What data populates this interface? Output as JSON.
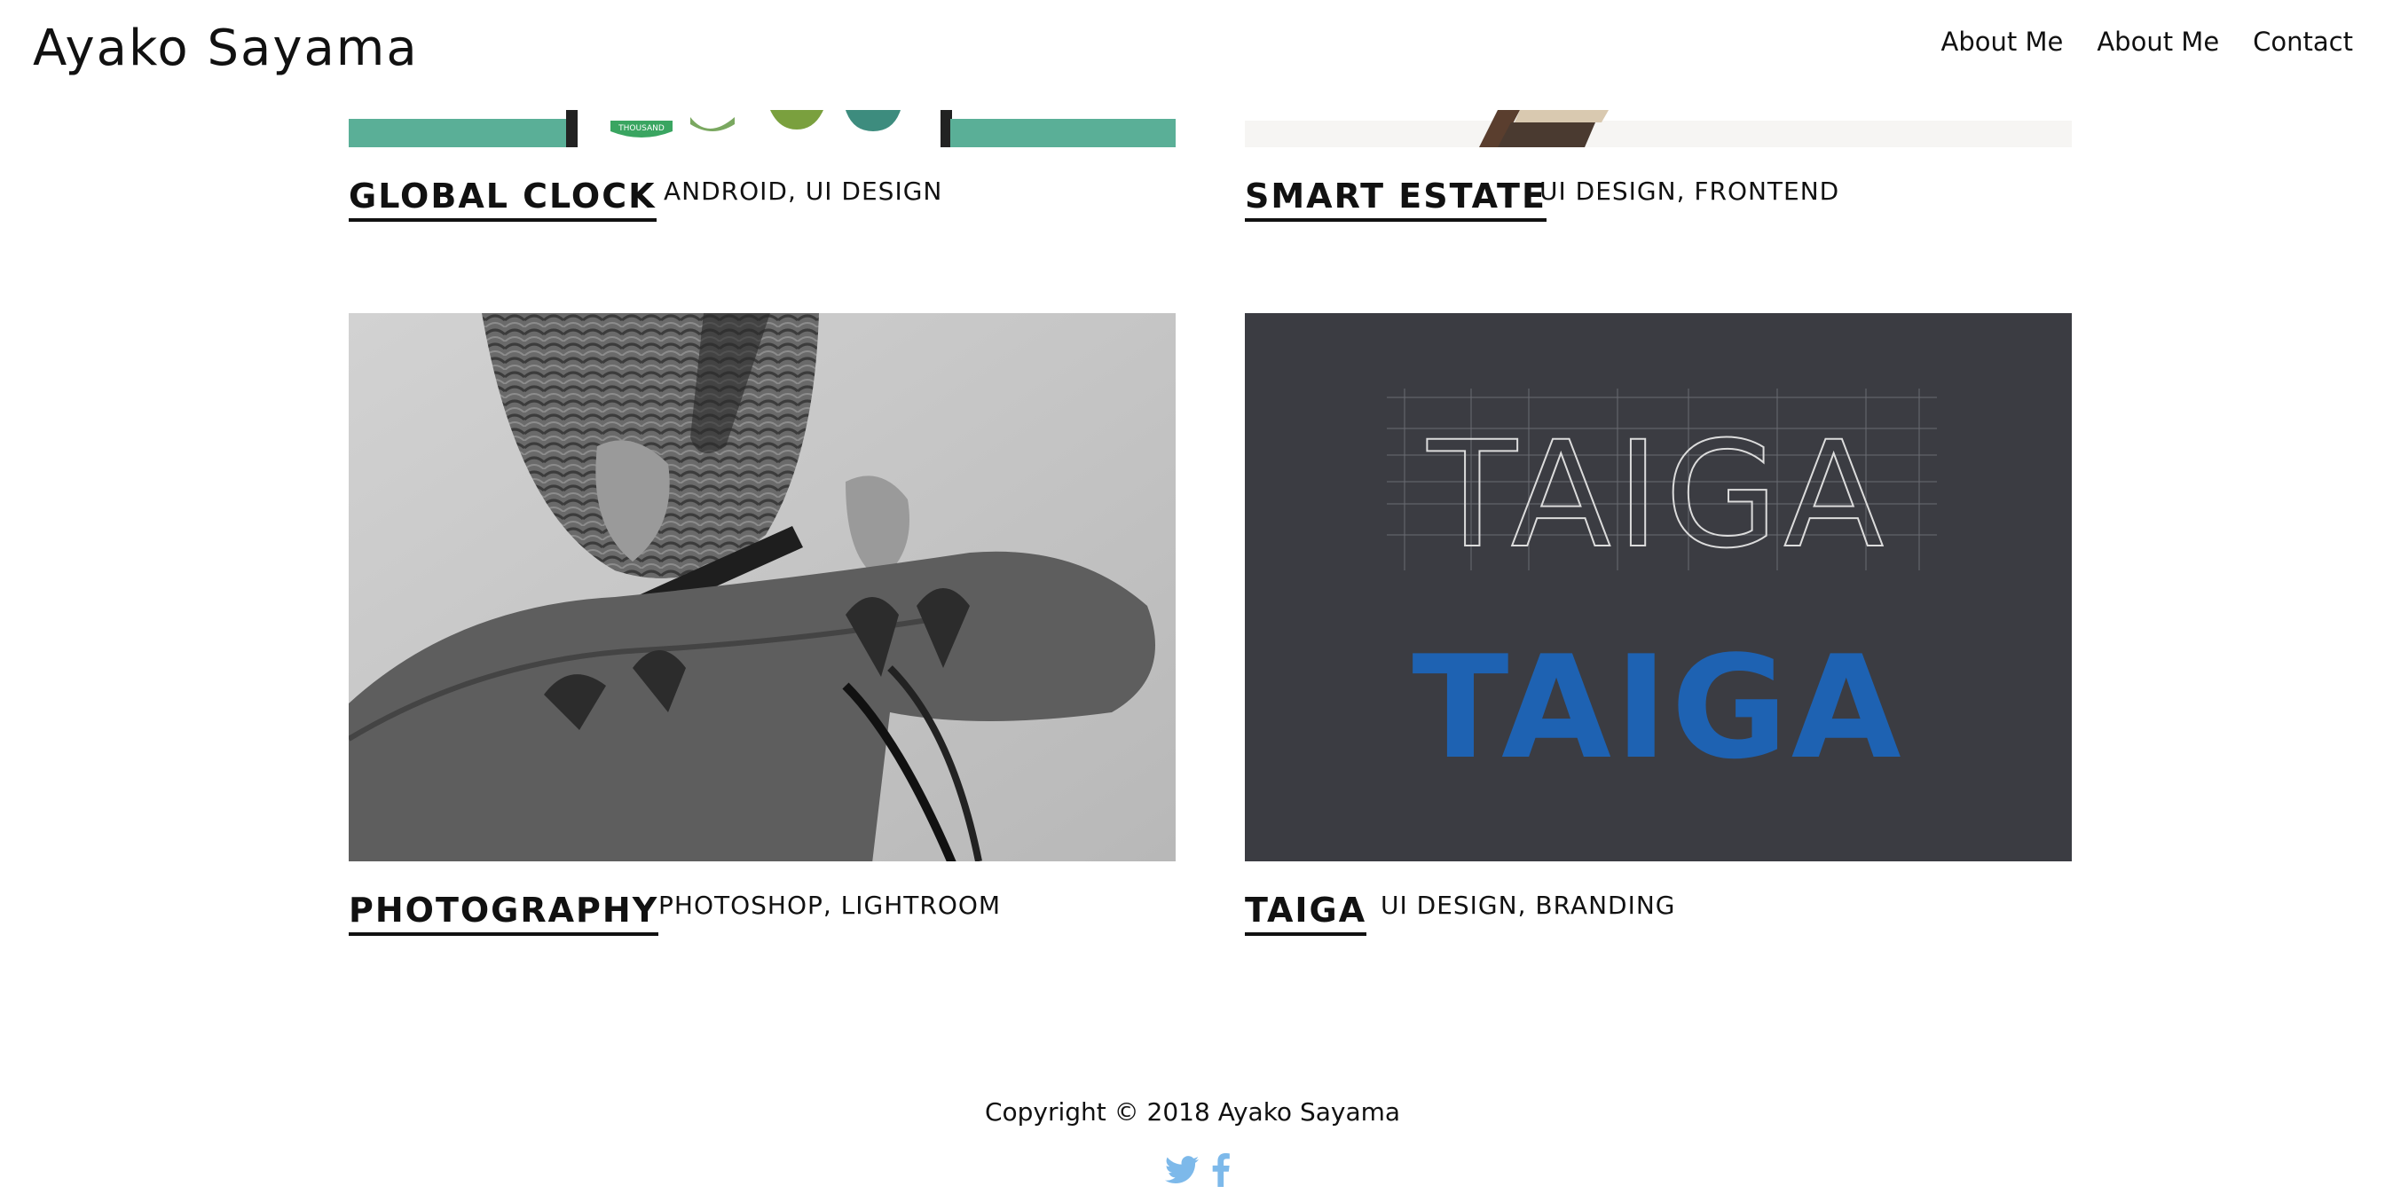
{
  "header": {
    "brand": "Ayako Sayama",
    "nav": [
      {
        "label": "About Me"
      },
      {
        "label": "About Me"
      },
      {
        "label": "Contact"
      }
    ]
  },
  "projects": [
    {
      "title": "GLOBAL CLOCK",
      "tags": "ANDROID, UI DESIGN"
    },
    {
      "title": "SMART ESTATE",
      "tags": "UI DESIGN, FRONTEND"
    },
    {
      "title": "PHOTOGRAPHY",
      "tags": "PHOTOSHOP, LIGHTROOM"
    },
    {
      "title": "TAIGA",
      "tags": "UI DESIGN, BRANDING"
    }
  ],
  "global_clock_badge": "THOUSAND",
  "taiga_logo": {
    "outline_text": "TAIGA",
    "solid_text": "TAIGA"
  },
  "footer": {
    "copyright": "Copyright © 2018 Ayako Sayama",
    "social_icons": [
      "twitter-icon",
      "facebook-icon"
    ]
  },
  "colors": {
    "teal": "#5aaf97",
    "taiga_bg": "#3b3c42",
    "taiga_blue": "#1e62b2",
    "social_blue": "#7db9ea"
  }
}
